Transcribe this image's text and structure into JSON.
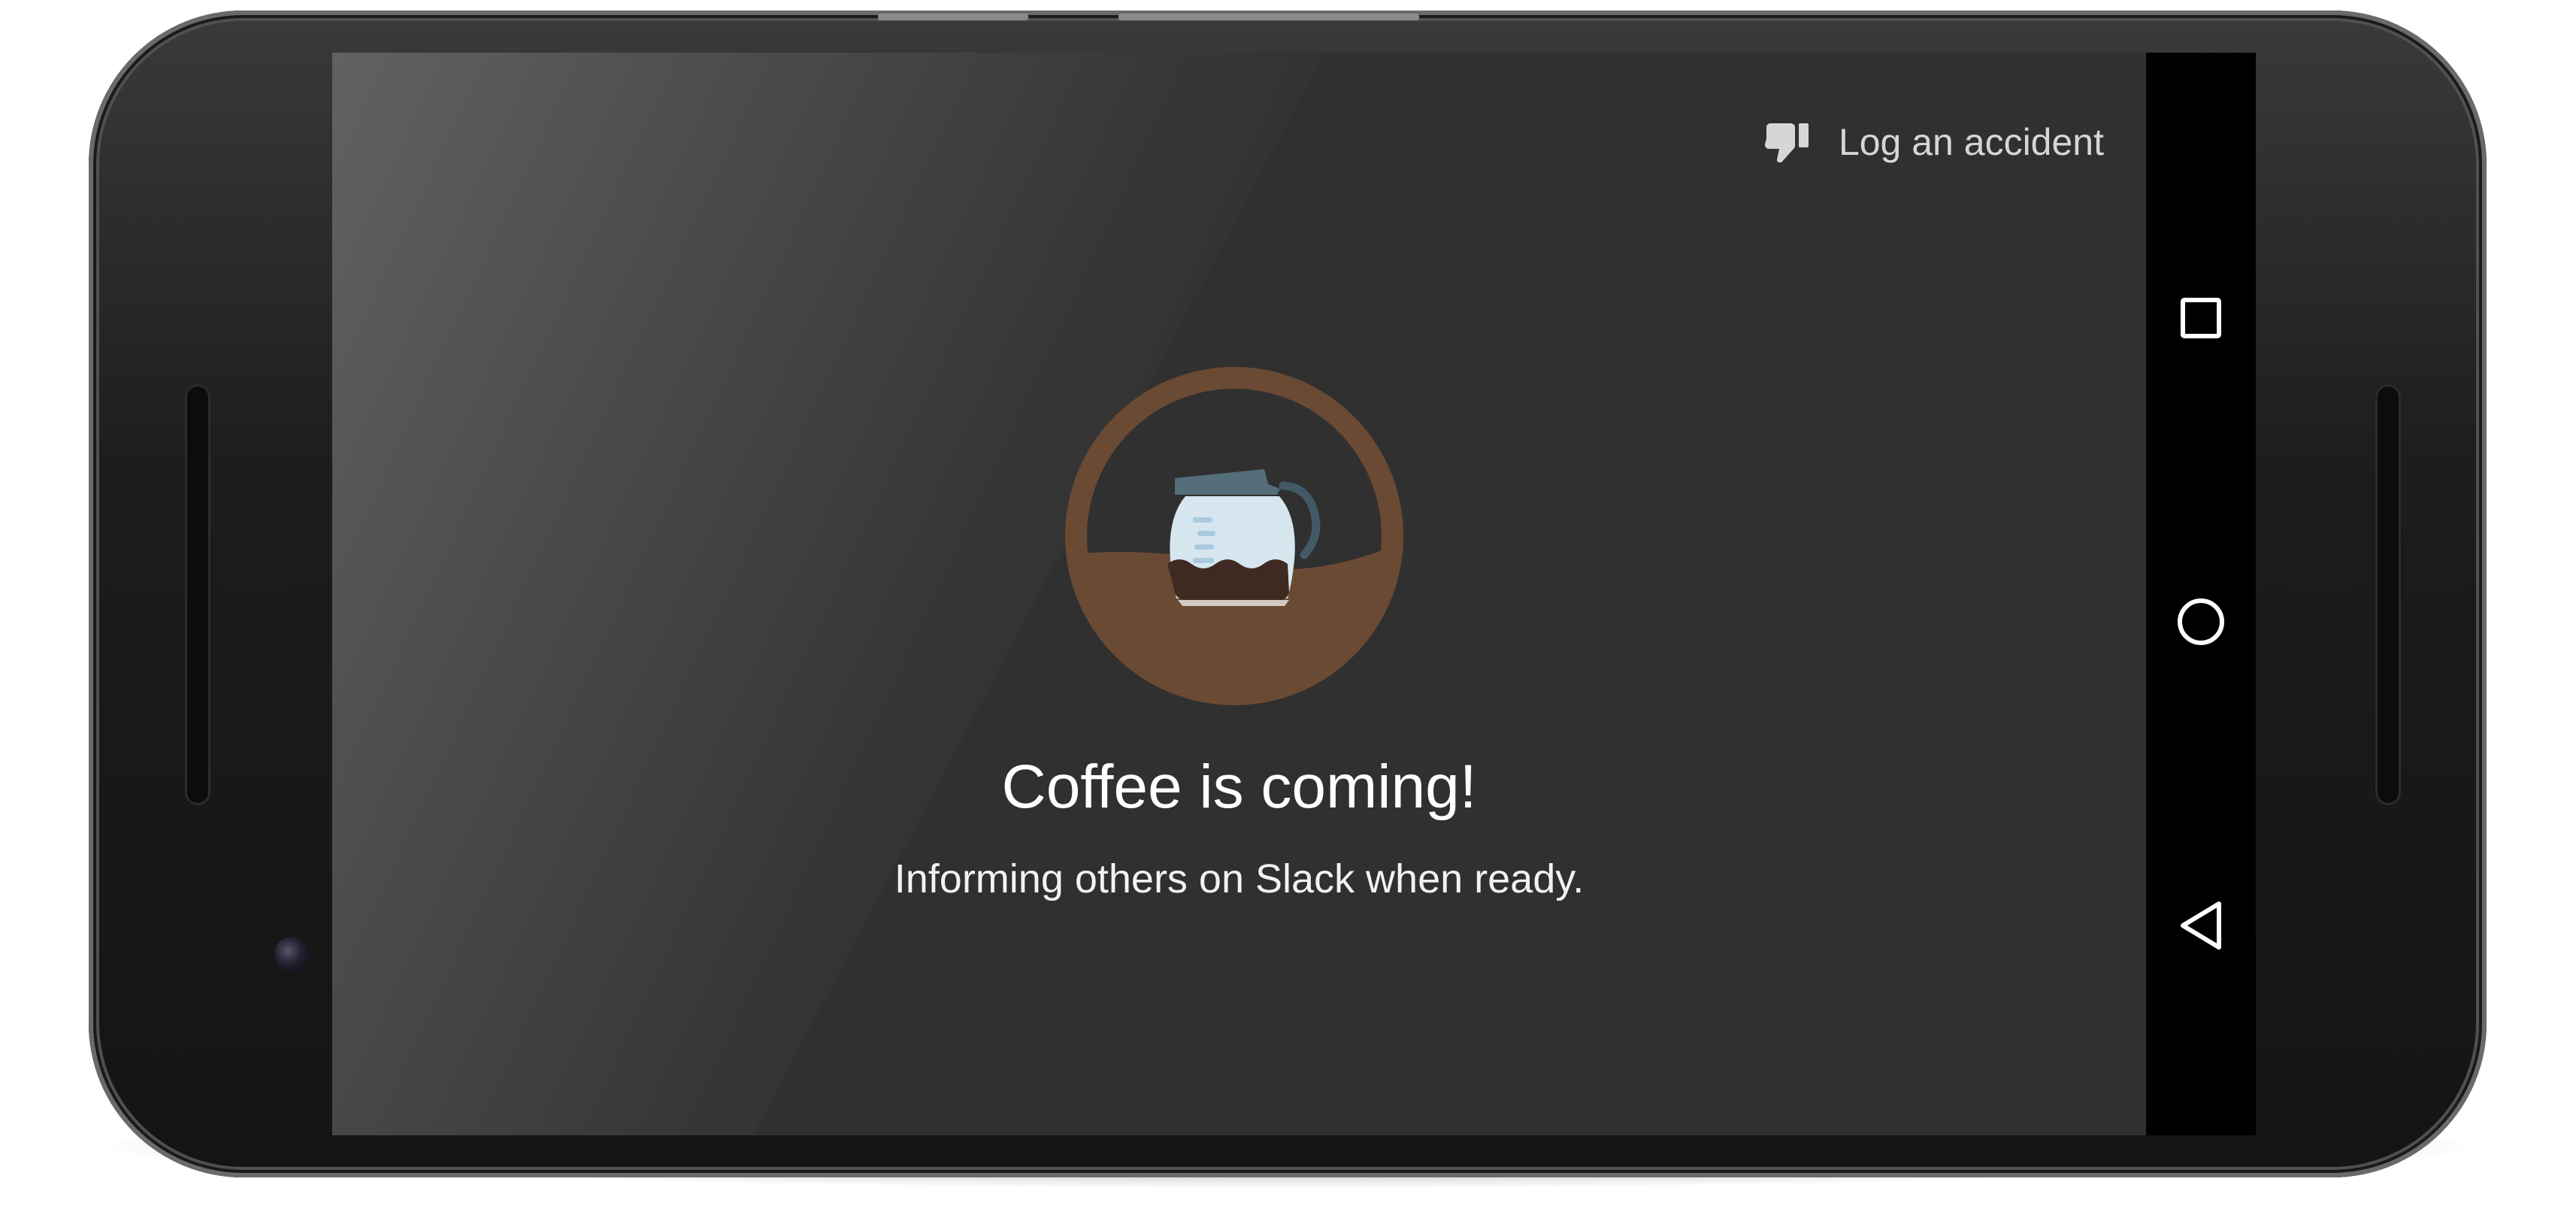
{
  "action_bar": {
    "log_accident_label": "Log an accident",
    "log_accident_icon": "thumb-down-icon"
  },
  "main": {
    "title": "Coffee is coming!",
    "subtitle": "Informing others on Slack when ready.",
    "illustration": "coffee-pot-icon"
  },
  "nav_bar": {
    "recents_icon": "square-icon",
    "home_icon": "circle-icon",
    "back_icon": "triangle-back-icon"
  },
  "colors": {
    "screen_background": "#303030",
    "coffee_brown": "#6b4a34",
    "pot_glass": "#d6e6ef",
    "pot_lid": "#546e7a",
    "coffee_liquid": "#3e2a22"
  }
}
